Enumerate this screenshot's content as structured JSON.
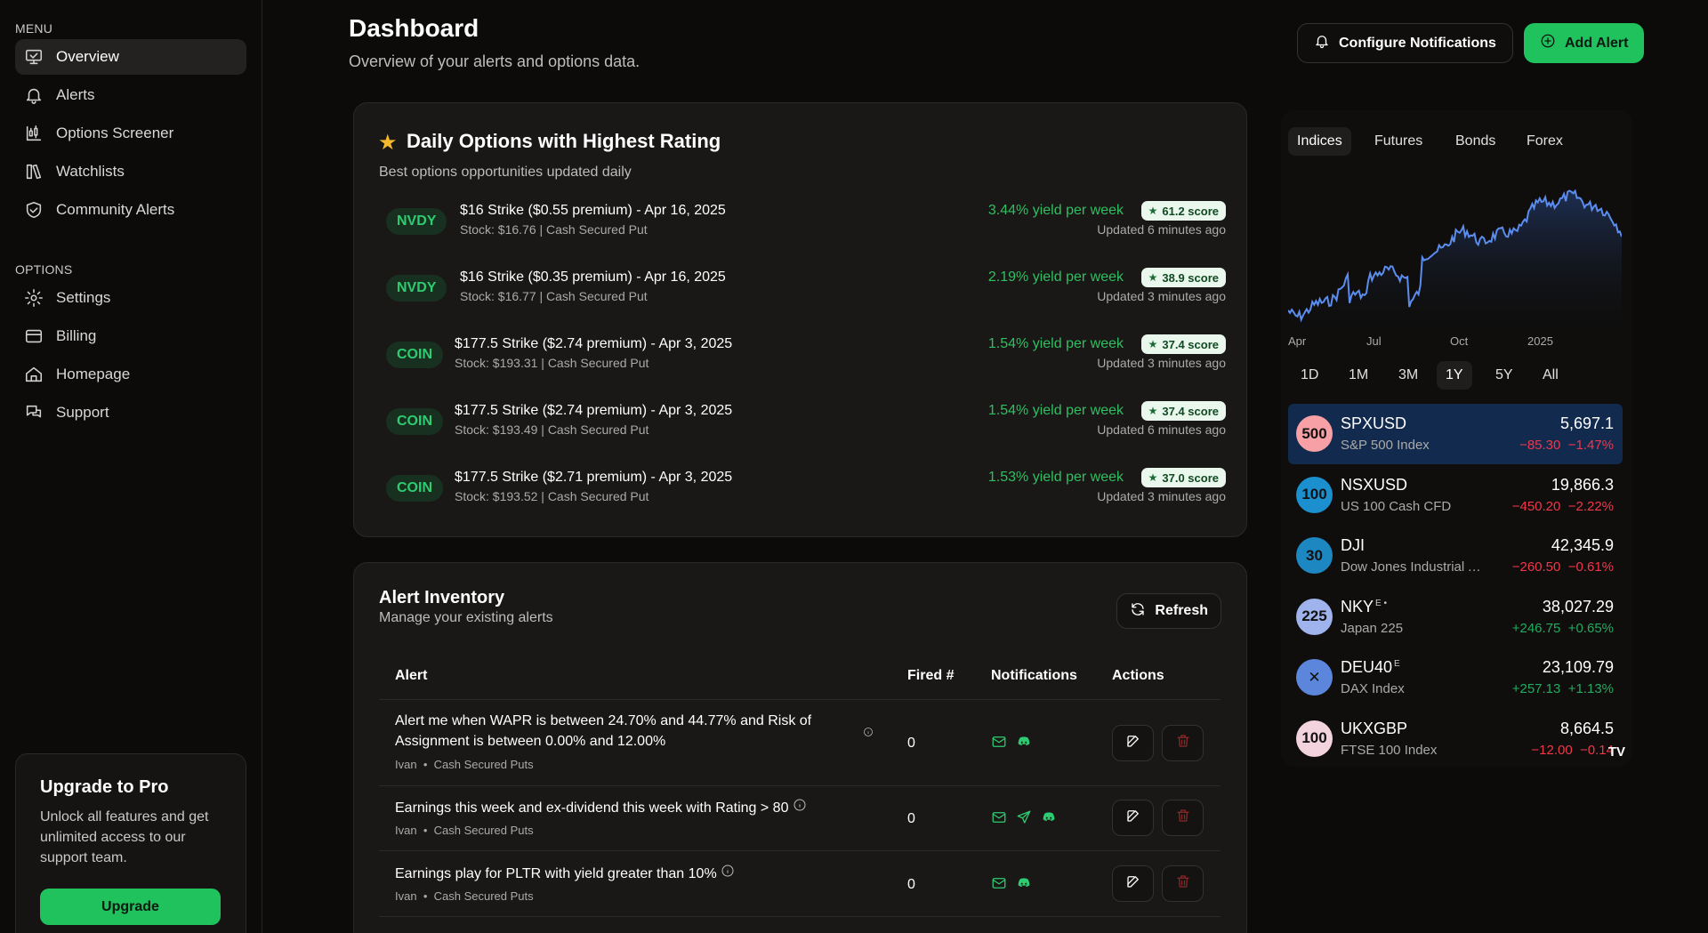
{
  "sidebar": {
    "menu_label": "MENU",
    "menu_items": [
      {
        "label": "Overview",
        "icon": "monitor-icon",
        "active": true
      },
      {
        "label": "Alerts",
        "icon": "bell-icon"
      },
      {
        "label": "Options Screener",
        "icon": "chart-candles-icon"
      },
      {
        "label": "Watchlists",
        "icon": "list-book-icon"
      },
      {
        "label": "Community Alerts",
        "icon": "handshake-icon"
      }
    ],
    "options_label": "OPTIONS",
    "option_items": [
      {
        "label": "Settings",
        "icon": "gear-icon"
      },
      {
        "label": "Billing",
        "icon": "credit-card-icon"
      },
      {
        "label": "Homepage",
        "icon": "home-icon"
      },
      {
        "label": "Support",
        "icon": "chat-icon"
      }
    ],
    "upgrade": {
      "title": "Upgrade to Pro",
      "text": "Unlock all features and get unlimited access to our support team.",
      "button": "Upgrade"
    }
  },
  "header": {
    "title": "Dashboard",
    "subtitle": "Overview of your alerts and options data.",
    "configure_button": "Configure Notifications",
    "add_button": "Add Alert"
  },
  "daily_options": {
    "title": "Daily Options with Highest Rating",
    "subtitle": "Best options opportunities updated daily",
    "items": [
      {
        "ticker": "NVDY",
        "title": "$16 Strike ($0.55 premium) - Apr 16, 2025",
        "meta": "Stock: $16.76 | Cash Secured Put",
        "yield": "3.44% yield per week",
        "score": "61.2 score",
        "updated": "Updated 6 minutes ago"
      },
      {
        "ticker": "NVDY",
        "title": "$16 Strike ($0.35 premium) - Apr 16, 2025",
        "meta": "Stock: $16.77 | Cash Secured Put",
        "yield": "2.19% yield per week",
        "score": "38.9 score",
        "updated": "Updated 3 minutes ago"
      },
      {
        "ticker": "COIN",
        "title": "$177.5 Strike ($2.74 premium) - Apr 3, 2025",
        "meta": "Stock: $193.31 | Cash Secured Put",
        "yield": "1.54% yield per week",
        "score": "37.4 score",
        "updated": "Updated 3 minutes ago"
      },
      {
        "ticker": "COIN",
        "title": "$177.5 Strike ($2.74 premium) - Apr 3, 2025",
        "meta": "Stock: $193.49 | Cash Secured Put",
        "yield": "1.54% yield per week",
        "score": "37.4 score",
        "updated": "Updated 6 minutes ago"
      },
      {
        "ticker": "COIN",
        "title": "$177.5 Strike ($2.71 premium) - Apr 3, 2025",
        "meta": "Stock: $193.52 | Cash Secured Put",
        "yield": "1.53% yield per week",
        "score": "37.0 score",
        "updated": "Updated 3 minutes ago"
      }
    ]
  },
  "inventory": {
    "title": "Alert Inventory",
    "subtitle": "Manage your existing alerts",
    "refresh_button": "Refresh",
    "columns": [
      "Alert",
      "Fired #",
      "Notifications",
      "Actions"
    ],
    "rows": [
      {
        "text": "Alert me when WAPR is between 24.70% and 44.77% and Risk of Assignment is between 0.00% and 12.00%",
        "user": "Ivan",
        "category": "Cash Secured Puts",
        "fired": "0",
        "notifications": [
          "mail-icon",
          "discord-icon"
        ]
      },
      {
        "text": "Earnings this week and ex-dividend this week with Rating > 80",
        "user": "Ivan",
        "category": "Cash Secured Puts",
        "fired": "0",
        "notifications": [
          "mail-icon",
          "send-icon",
          "discord-icon"
        ]
      },
      {
        "text": "Earnings play for PLTR with yield greater than 10%",
        "user": "Ivan",
        "category": "Cash Secured Puts",
        "fired": "0",
        "notifications": [
          "mail-icon",
          "discord-icon"
        ]
      }
    ],
    "meta_separator": "•"
  },
  "market": {
    "tabs": [
      "Indices",
      "Futures",
      "Bonds",
      "Forex"
    ],
    "active_tab": "Indices",
    "chart_data": {
      "type": "area",
      "x_ticks": [
        "Apr",
        "Jul",
        "Oct",
        "2025"
      ],
      "color": "#5b8def"
    },
    "ranges": [
      "1D",
      "1M",
      "3M",
      "1Y",
      "5Y",
      "All"
    ],
    "active_range": "1Y",
    "symbols": [
      {
        "logo": "500",
        "logo_color": "#f7a1a6",
        "name": "SPXUSD",
        "sup": "",
        "desc": "S&P 500 Index",
        "price": "5,697.1",
        "chg": "−85.30",
        "pct": "−1.47%",
        "dir": "neg",
        "active": true
      },
      {
        "logo": "100",
        "logo_color": "#1c8fcf",
        "name": "NSXUSD",
        "sup": "",
        "desc": "US 100 Cash CFD",
        "price": "19,866.3",
        "chg": "−450.20",
        "pct": "−2.22%",
        "dir": "neg"
      },
      {
        "logo": "30",
        "logo_color": "#1d87c2",
        "name": "DJI",
        "sup": "",
        "desc": "Dow Jones Industrial Average",
        "price": "42,345.9",
        "chg": "−260.50",
        "pct": "−0.61%",
        "dir": "neg"
      },
      {
        "logo": "225",
        "logo_color": "#9fb3ec",
        "name": "NKY",
        "sup": "E •",
        "desc": "Japan 225",
        "price": "38,027.29",
        "chg": "+246.75",
        "pct": "+0.65%",
        "dir": "pos"
      },
      {
        "logo": "✕",
        "logo_color": "#5b86db",
        "name": "DEU40",
        "sup": "E",
        "desc": "DAX Index",
        "price": "23,109.79",
        "chg": "+257.13",
        "pct": "+1.13%",
        "dir": "pos"
      },
      {
        "logo": "100",
        "logo_color": "#f3d3dd",
        "name": "UKXGBP",
        "sup": "",
        "desc": "FTSE 100 Index",
        "price": "8,664.5",
        "chg": "−12.00",
        "pct": "−0.14",
        "dir": "neg"
      }
    ],
    "watermark": "TV"
  },
  "colors": {
    "accent": "#1fc25c",
    "negative": "#f2364a",
    "positive": "#22ab5f"
  }
}
